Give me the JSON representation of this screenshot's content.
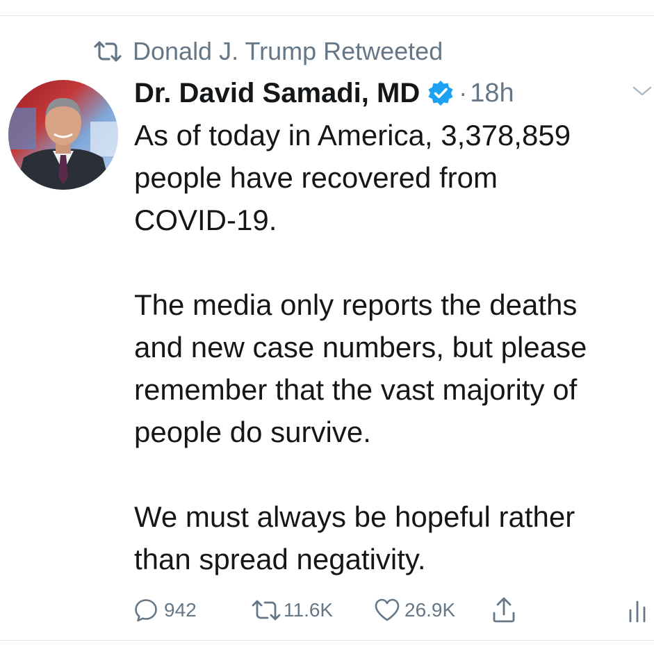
{
  "retweet_context": {
    "label": "Donald J. Trump Retweeted",
    "icon": "retweet-icon"
  },
  "author": {
    "name": "Dr. David Samadi, MD",
    "verified": true,
    "verified_color": "#1da1f2"
  },
  "meta": {
    "separator": "·",
    "timestamp": "18h"
  },
  "tweet": {
    "paragraphs": [
      "As of today in America, 3,378,859\npeople have recovered from\nCOVID-19.",
      "The media only reports the deaths\nand new case numbers, but please\nremember that the vast majority of\npeople do survive.",
      "We must always be hopeful rather\nthan spread negativity."
    ]
  },
  "actions": {
    "replies": "942",
    "retweets": "11.6K",
    "likes": "26.9K",
    "share_icon": "share-icon",
    "analytics_icon": "analytics-icon"
  },
  "colors": {
    "text": "#14171a",
    "secondary": "#657786",
    "divider": "#e1e8ed"
  }
}
